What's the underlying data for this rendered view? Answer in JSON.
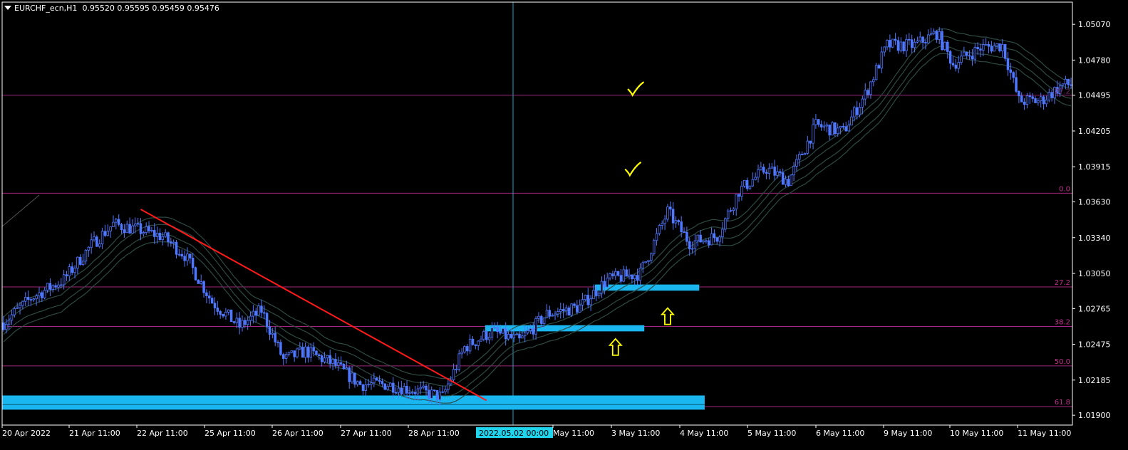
{
  "symbol_header": {
    "symbol": "EURCHF_ecn,H1",
    "quote": "0.95520 0.95595 0.95459 0.95476"
  },
  "colors": {
    "background": "#000000",
    "frame": "#ffffff",
    "candle": "#4f78ff",
    "ma_bands": "#2f4a44",
    "fib_line": "#a0267a",
    "fib_label": "#c0308d",
    "trendline": "#ff1a1a",
    "zone": "#19b6f0",
    "cursor": "#1fa3c5",
    "annotation": "#ffff00"
  },
  "chart_data": {
    "type": "candlestick",
    "timeframe": "H1",
    "ylim": [
      1.0182,
      1.0525
    ],
    "y_ticks": [
      "1.05070",
      "1.04780",
      "1.04495",
      "1.04205",
      "1.03915",
      "1.03630",
      "1.03340",
      "1.03050",
      "1.02765",
      "1.02475",
      "1.02185",
      "1.01900"
    ],
    "x_ticks": [
      "20 Apr 2022",
      "21 Apr 11:00",
      "22 Apr 11:00",
      "25 Apr 11:00",
      "26 Apr 11:00",
      "27 Apr 11:00",
      "28 Apr 11:00",
      "2022.05.02 00:00",
      "May 11:00",
      "3 May 11:00",
      "4 May 11:00",
      "5 May 11:00",
      "6 May 11:00",
      "9 May 11:00",
      "10 May 11:00",
      "11 May 11:00"
    ],
    "crosshair_time": "2022.05.02 00:00",
    "close_path": [
      {
        "bar": 0,
        "price": 1.0265
      },
      {
        "bar": 10,
        "price": 1.0285
      },
      {
        "bar": 22,
        "price": 1.03
      },
      {
        "bar": 32,
        "price": 1.0328
      },
      {
        "bar": 40,
        "price": 1.0345
      },
      {
        "bar": 50,
        "price": 1.034
      },
      {
        "bar": 58,
        "price": 1.0335
      },
      {
        "bar": 66,
        "price": 1.032
      },
      {
        "bar": 76,
        "price": 1.0282
      },
      {
        "bar": 86,
        "price": 1.0262
      },
      {
        "bar": 94,
        "price": 1.0275
      },
      {
        "bar": 102,
        "price": 1.0235
      },
      {
        "bar": 110,
        "price": 1.0242
      },
      {
        "bar": 120,
        "price": 1.0232
      },
      {
        "bar": 130,
        "price": 1.0215
      },
      {
        "bar": 140,
        "price": 1.0215
      },
      {
        "bar": 150,
        "price": 1.021
      },
      {
        "bar": 160,
        "price": 1.0205
      },
      {
        "bar": 168,
        "price": 1.0245
      },
      {
        "bar": 178,
        "price": 1.0258
      },
      {
        "bar": 188,
        "price": 1.025
      },
      {
        "bar": 198,
        "price": 1.0272
      },
      {
        "bar": 210,
        "price": 1.0278
      },
      {
        "bar": 220,
        "price": 1.03
      },
      {
        "bar": 232,
        "price": 1.0305
      },
      {
        "bar": 242,
        "price": 1.0355
      },
      {
        "bar": 250,
        "price": 1.033
      },
      {
        "bar": 260,
        "price": 1.0335
      },
      {
        "bar": 268,
        "price": 1.0372
      },
      {
        "bar": 278,
        "price": 1.039
      },
      {
        "bar": 286,
        "price": 1.038
      },
      {
        "bar": 296,
        "price": 1.0425
      },
      {
        "bar": 306,
        "price": 1.042
      },
      {
        "bar": 314,
        "price": 1.045
      },
      {
        "bar": 322,
        "price": 1.049
      },
      {
        "bar": 332,
        "price": 1.049
      },
      {
        "bar": 340,
        "price": 1.05
      },
      {
        "bar": 346,
        "price": 1.0475
      },
      {
        "bar": 356,
        "price": 1.0488
      },
      {
        "bar": 364,
        "price": 1.049
      },
      {
        "bar": 370,
        "price": 1.0445
      },
      {
        "bar": 378,
        "price": 1.0445
      },
      {
        "bar": 386,
        "price": 1.0458
      }
    ],
    "fibonacci_levels": [
      {
        "label": "",
        "price": 1.04495
      },
      {
        "label": "0.0",
        "price": 1.037
      },
      {
        "label": "27.2",
        "price": 1.0294
      },
      {
        "label": "38.2",
        "price": 1.0262
      },
      {
        "label": "50.0",
        "price": 1.023
      },
      {
        "label": "61.8",
        "price": 1.0197
      }
    ],
    "fib_top_label": "27.2",
    "trendline": {
      "from": {
        "bar": 50,
        "price": 1.0357
      },
      "to": {
        "bar": 176,
        "price": 1.0202
      }
    },
    "support_zones": [
      {
        "from_bar": 0,
        "to_bar": 256,
        "price_high": 1.0206,
        "price_low": 1.01945
      },
      {
        "from_bar": 176,
        "to_bar": 234,
        "price_high": 1.0263,
        "price_low": 1.0258
      },
      {
        "from_bar": 216,
        "to_bar": 254,
        "price_high": 1.0296,
        "price_low": 1.0291
      }
    ],
    "annotations": {
      "checkmarks": [
        {
          "bar": 230,
          "price": 1.0453
        },
        {
          "bar": 229,
          "price": 1.0388
        }
      ],
      "up_arrows": [
        {
          "bar": 223,
          "price": 1.0245
        },
        {
          "bar": 242,
          "price": 1.027
        }
      ]
    }
  }
}
